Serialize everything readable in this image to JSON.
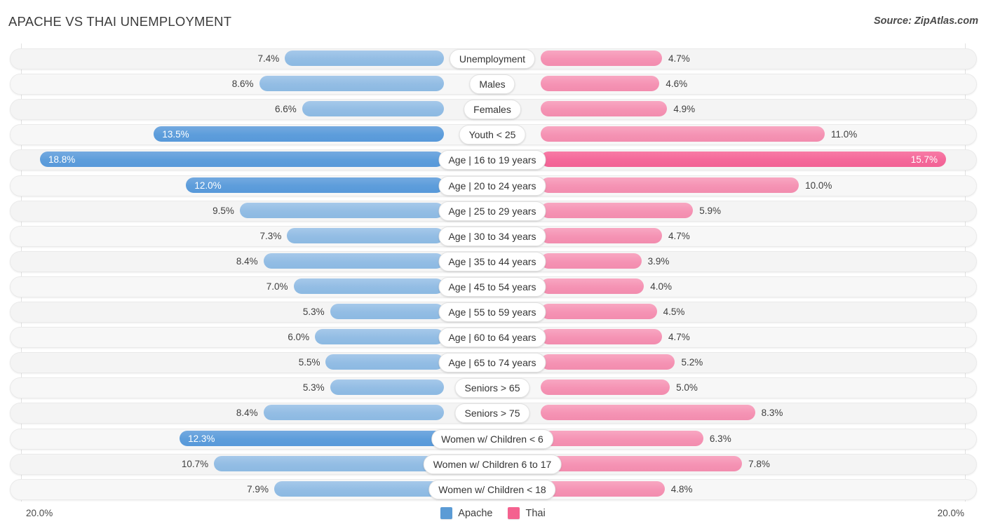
{
  "header": {
    "title": "APACHE VS THAI UNEMPLOYMENT",
    "source": "Source: ZipAtlas.com"
  },
  "axis": {
    "min_label": "20.0%",
    "max_label": "20.0%",
    "max_value": 20.0
  },
  "legend": {
    "items": [
      {
        "label": "Apache",
        "color": "#5b9bd5"
      },
      {
        "label": "Thai",
        "color": "#f4628f"
      }
    ]
  },
  "colors": {
    "apache": "#93bde4",
    "apache_highlight": "#5d9ddb",
    "thai": "#f593b4",
    "thai_highlight": "#f4689a",
    "row_track": "#f4f4f4",
    "gridline": "#e2e2e2"
  },
  "chart_data": {
    "type": "bar",
    "orientation": "horizontal",
    "style": "diverging-bidirectional",
    "title": "APACHE VS THAI UNEMPLOYMENT",
    "xlabel": "",
    "ylabel": "",
    "xlim": [
      20.0,
      20.0
    ],
    "grid": true,
    "legend_position": "bottom-center",
    "series": [
      {
        "name": "Apache",
        "side": "left",
        "values": [
          7.4,
          8.6,
          6.6,
          13.5,
          18.8,
          12.0,
          9.5,
          7.3,
          8.4,
          7.0,
          5.3,
          6.0,
          5.5,
          5.3,
          8.4,
          12.3,
          10.7,
          7.9
        ]
      },
      {
        "name": "Thai",
        "side": "right",
        "values": [
          4.7,
          4.6,
          4.9,
          11.0,
          15.7,
          10.0,
          5.9,
          4.7,
          3.9,
          4.0,
          4.5,
          4.7,
          5.2,
          5.0,
          8.3,
          6.3,
          7.8,
          4.8
        ]
      }
    ],
    "categories": [
      "Unemployment",
      "Males",
      "Females",
      "Youth < 25",
      "Age | 16 to 19 years",
      "Age | 20 to 24 years",
      "Age | 25 to 29 years",
      "Age | 30 to 34 years",
      "Age | 35 to 44 years",
      "Age | 45 to 54 years",
      "Age | 55 to 59 years",
      "Age | 60 to 64 years",
      "Age | 65 to 74 years",
      "Seniors > 65",
      "Seniors > 75",
      "Women w/ Children < 6",
      "Women w/ Children 6 to 17",
      "Women w/ Children < 18"
    ]
  },
  "rows": [
    {
      "category": "Unemployment",
      "left_value": 7.4,
      "left_label": "7.4%",
      "right_value": 4.7,
      "right_label": "4.7%",
      "left_inside": false,
      "right_inside": false
    },
    {
      "category": "Males",
      "left_value": 8.6,
      "left_label": "8.6%",
      "right_value": 4.6,
      "right_label": "4.6%",
      "left_inside": false,
      "right_inside": false
    },
    {
      "category": "Females",
      "left_value": 6.6,
      "left_label": "6.6%",
      "right_value": 4.9,
      "right_label": "4.9%",
      "left_inside": false,
      "right_inside": false
    },
    {
      "category": "Youth < 25",
      "left_value": 13.5,
      "left_label": "13.5%",
      "right_value": 11.0,
      "right_label": "11.0%",
      "left_inside": true,
      "right_inside": false
    },
    {
      "category": "Age | 16 to 19 years",
      "left_value": 18.8,
      "left_label": "18.8%",
      "right_value": 15.7,
      "right_label": "15.7%",
      "left_inside": true,
      "right_inside": true
    },
    {
      "category": "Age | 20 to 24 years",
      "left_value": 12.0,
      "left_label": "12.0%",
      "right_value": 10.0,
      "right_label": "10.0%",
      "left_inside": true,
      "right_inside": false
    },
    {
      "category": "Age | 25 to 29 years",
      "left_value": 9.5,
      "left_label": "9.5%",
      "right_value": 5.9,
      "right_label": "5.9%",
      "left_inside": false,
      "right_inside": false
    },
    {
      "category": "Age | 30 to 34 years",
      "left_value": 7.3,
      "left_label": "7.3%",
      "right_value": 4.7,
      "right_label": "4.7%",
      "left_inside": false,
      "right_inside": false
    },
    {
      "category": "Age | 35 to 44 years",
      "left_value": 8.4,
      "left_label": "8.4%",
      "right_value": 3.9,
      "right_label": "3.9%",
      "left_inside": false,
      "right_inside": false
    },
    {
      "category": "Age | 45 to 54 years",
      "left_value": 7.0,
      "left_label": "7.0%",
      "right_value": 4.0,
      "right_label": "4.0%",
      "left_inside": false,
      "right_inside": false
    },
    {
      "category": "Age | 55 to 59 years",
      "left_value": 5.3,
      "left_label": "5.3%",
      "right_value": 4.5,
      "right_label": "4.5%",
      "left_inside": false,
      "right_inside": false
    },
    {
      "category": "Age | 60 to 64 years",
      "left_value": 6.0,
      "left_label": "6.0%",
      "right_value": 4.7,
      "right_label": "4.7%",
      "left_inside": false,
      "right_inside": false
    },
    {
      "category": "Age | 65 to 74 years",
      "left_value": 5.5,
      "left_label": "5.5%",
      "right_value": 5.2,
      "right_label": "5.2%",
      "left_inside": false,
      "right_inside": false
    },
    {
      "category": "Seniors > 65",
      "left_value": 5.3,
      "left_label": "5.3%",
      "right_value": 5.0,
      "right_label": "5.0%",
      "left_inside": false,
      "right_inside": false
    },
    {
      "category": "Seniors > 75",
      "left_value": 8.4,
      "left_label": "8.4%",
      "right_value": 8.3,
      "right_label": "8.3%",
      "left_inside": false,
      "right_inside": false
    },
    {
      "category": "Women w/ Children < 6",
      "left_value": 12.3,
      "left_label": "12.3%",
      "right_value": 6.3,
      "right_label": "6.3%",
      "left_inside": true,
      "right_inside": false
    },
    {
      "category": "Women w/ Children 6 to 17",
      "left_value": 10.7,
      "left_label": "10.7%",
      "right_value": 7.8,
      "right_label": "7.8%",
      "left_inside": false,
      "right_inside": false
    },
    {
      "category": "Women w/ Children < 18",
      "left_value": 7.9,
      "left_label": "7.9%",
      "right_value": 4.8,
      "right_label": "4.8%",
      "left_inside": false,
      "right_inside": false
    }
  ]
}
